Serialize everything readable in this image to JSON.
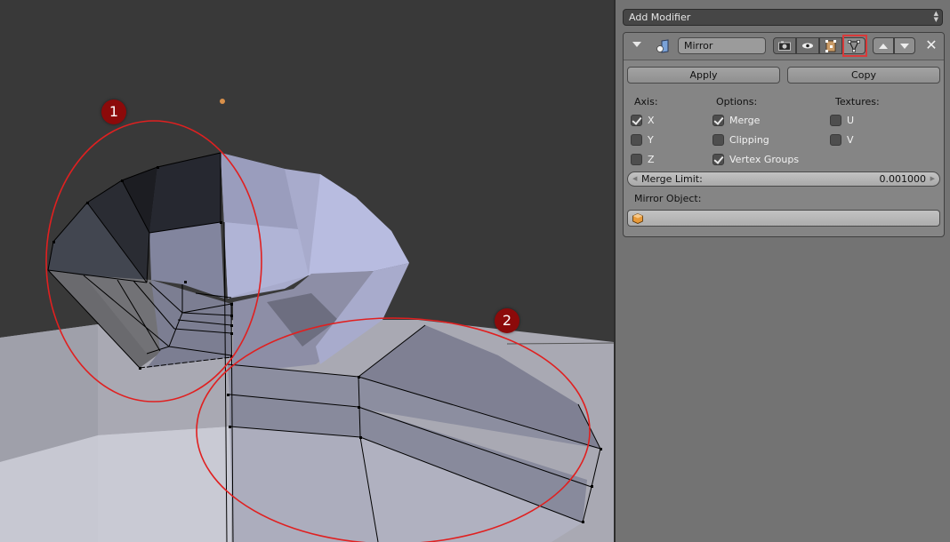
{
  "viewport": {
    "annotations": [
      {
        "label": "1"
      },
      {
        "label": "2"
      }
    ],
    "colors": {
      "background": "#393939",
      "annotation_ring": "#e02020",
      "badge": "#8c0a0a",
      "mesh_light": "#b4b8d8",
      "mesh_shadow": "#262830"
    }
  },
  "panel": {
    "add_modifier": {
      "label": "Add Modifier"
    },
    "modifier": {
      "name": "Mirror",
      "header_icons": [
        "render-camera-icon",
        "viewport-eye-icon",
        "edit-mode-icon",
        "cage-vertex-icon"
      ],
      "highlighted_icon": "cage-vertex-icon",
      "apply_label": "Apply",
      "copy_label": "Copy",
      "axis": {
        "title": "Axis:",
        "items": [
          {
            "label": "X",
            "checked": true
          },
          {
            "label": "Y",
            "checked": false
          },
          {
            "label": "Z",
            "checked": false
          }
        ]
      },
      "options": {
        "title": "Options:",
        "items": [
          {
            "label": "Merge",
            "checked": true
          },
          {
            "label": "Clipping",
            "checked": false
          },
          {
            "label": "Vertex Groups",
            "checked": true
          }
        ]
      },
      "textures": {
        "title": "Textures:",
        "items": [
          {
            "label": "U",
            "checked": false
          },
          {
            "label": "V",
            "checked": false
          }
        ]
      },
      "merge_limit": {
        "label": "Merge Limit:",
        "value": "0.001000"
      },
      "mirror_object": {
        "label": "Mirror Object:",
        "value": ""
      }
    }
  }
}
